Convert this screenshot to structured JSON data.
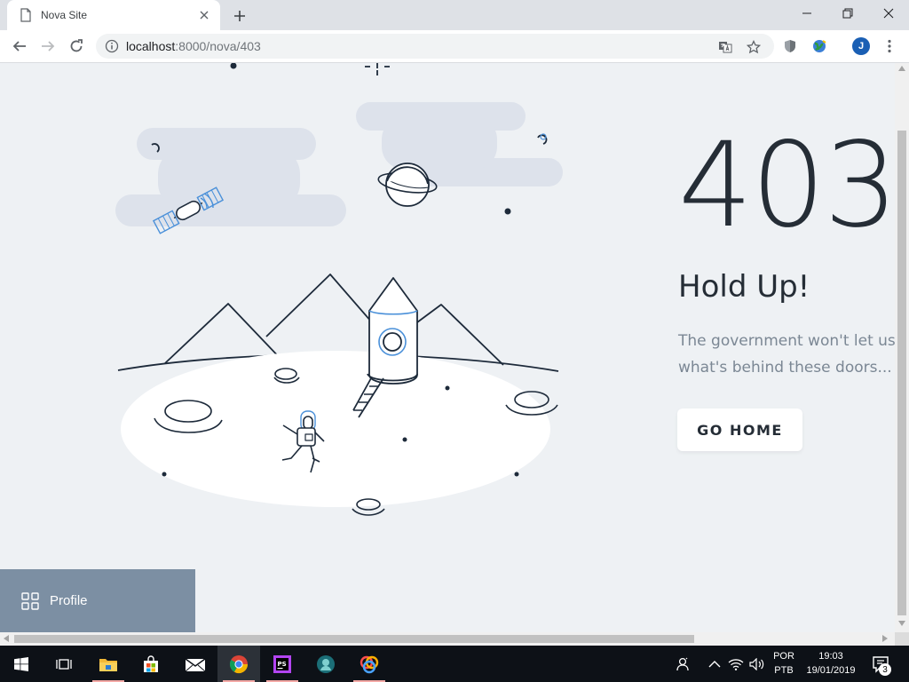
{
  "browser": {
    "tab_title": "Nova Site",
    "url_host": "localhost",
    "url_rest": ":8000/nova/403",
    "avatar_initial": "J"
  },
  "page": {
    "code": "403",
    "heading": "Hold Up!",
    "message_line1": "The government won't let us show you",
    "message_line2": "what's behind these doors...",
    "button_label": "GO HOME",
    "profile_label": "Profile"
  },
  "taskbar": {
    "lang_top": "POR",
    "lang_bottom": "PTB",
    "time": "19:03",
    "date": "19/01/2019",
    "notification_count": "3"
  },
  "colors": {
    "page_bg": "#eef1f4",
    "text_dark": "#252d36",
    "text_muted": "#7b8794",
    "accent_blue": "#4a90d9",
    "profile_bg": "#7c8fa3"
  },
  "icons": [
    "doc-icon",
    "close-icon",
    "plus-icon",
    "minimize-icon",
    "restore-icon",
    "window-close-icon",
    "back-icon",
    "forward-icon",
    "reload-icon",
    "info-icon",
    "translate-icon",
    "star-icon",
    "shield-icon",
    "globe-icon",
    "menu-dots-icon",
    "grid-icon",
    "windows-icon",
    "task-view-icon",
    "folder-icon",
    "store-icon",
    "mail-icon",
    "chrome-icon",
    "phpstorm-icon",
    "app-icon",
    "colorful-app-icon",
    "people-icon",
    "chevron-up-icon",
    "wifi-icon",
    "volume-icon",
    "notification-icon"
  ]
}
